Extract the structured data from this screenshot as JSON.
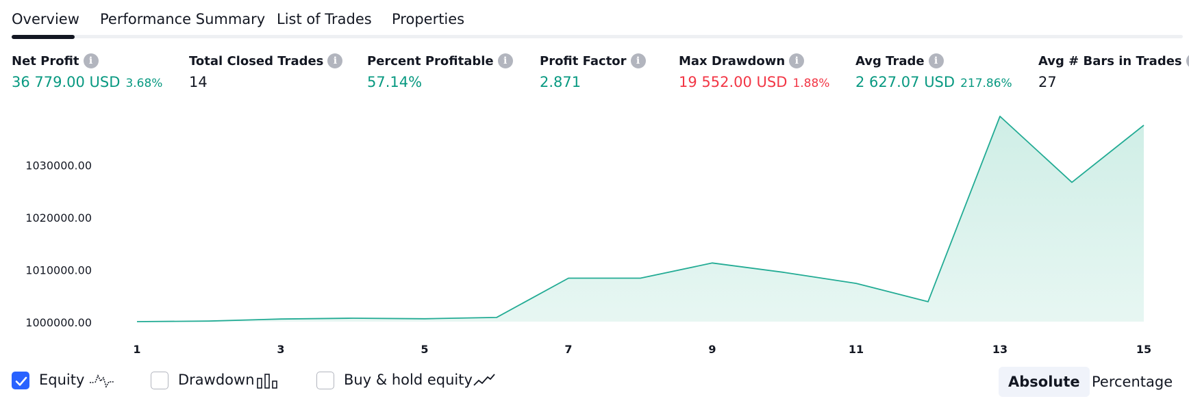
{
  "tabs": [
    {
      "label": "Overview",
      "active": true
    },
    {
      "label": "Performance Summary",
      "active": false
    },
    {
      "label": "List of Trades",
      "active": false
    },
    {
      "label": "Properties",
      "active": false
    }
  ],
  "metrics": [
    {
      "label": "Net Profit",
      "value": "36 779.00 USD",
      "percent": "3.68%",
      "color": "#089981"
    },
    {
      "label": "Total Closed Trades",
      "value": "14",
      "percent": "",
      "color": "#131722"
    },
    {
      "label": "Percent Profitable",
      "value": "57.14%",
      "percent": "",
      "color": "#089981"
    },
    {
      "label": "Profit Factor",
      "value": "2.871",
      "percent": "",
      "color": "#089981"
    },
    {
      "label": "Max Drawdown",
      "value": "19 552.00 USD",
      "percent": "1.88%",
      "color": "#f23645"
    },
    {
      "label": "Avg Trade",
      "value": "2 627.07 USD",
      "percent": "217.86%",
      "color": "#089981"
    },
    {
      "label": "Avg # Bars in Trades",
      "value": "27",
      "percent": "",
      "color": "#131722"
    }
  ],
  "info_icon": "info-icon",
  "chart_data": {
    "type": "area",
    "x": [
      1,
      2,
      3,
      4,
      5,
      6,
      7,
      8,
      9,
      10,
      11,
      12,
      13,
      14,
      15
    ],
    "series": [
      {
        "values": [
          1000000,
          1000100,
          1000500,
          1000650,
          1000550,
          1000800,
          1008300,
          1008300,
          1011200,
          1009400,
          1007300,
          1003800,
          1039200,
          1026600,
          1037500
        ],
        "color": "#22ab94",
        "fill": "#cfeee6"
      }
    ],
    "x_ticks": [
      1,
      3,
      5,
      7,
      9,
      11,
      13,
      15
    ],
    "y_ticks": [
      1000000,
      1010000,
      1020000,
      1030000
    ],
    "y_tick_labels": [
      "1000000.00",
      "1010000.00",
      "1020000.00",
      "1030000.00"
    ],
    "ylim": [
      1000000,
      1039200
    ],
    "grid": false
  },
  "toggles": [
    {
      "label": "Equity",
      "checked": true,
      "icon": "equity-line-icon"
    },
    {
      "label": "Drawdown",
      "checked": false,
      "icon": "drawdown-bars-icon"
    },
    {
      "label": "Buy & hold equity",
      "checked": false,
      "icon": "buy-hold-line-icon"
    }
  ],
  "mode": {
    "absolute_label": "Absolute",
    "percentage_label": "Percentage",
    "selected": "Absolute"
  },
  "colors": {
    "accent": "#2962ff",
    "profit": "#089981",
    "loss": "#f23645"
  }
}
